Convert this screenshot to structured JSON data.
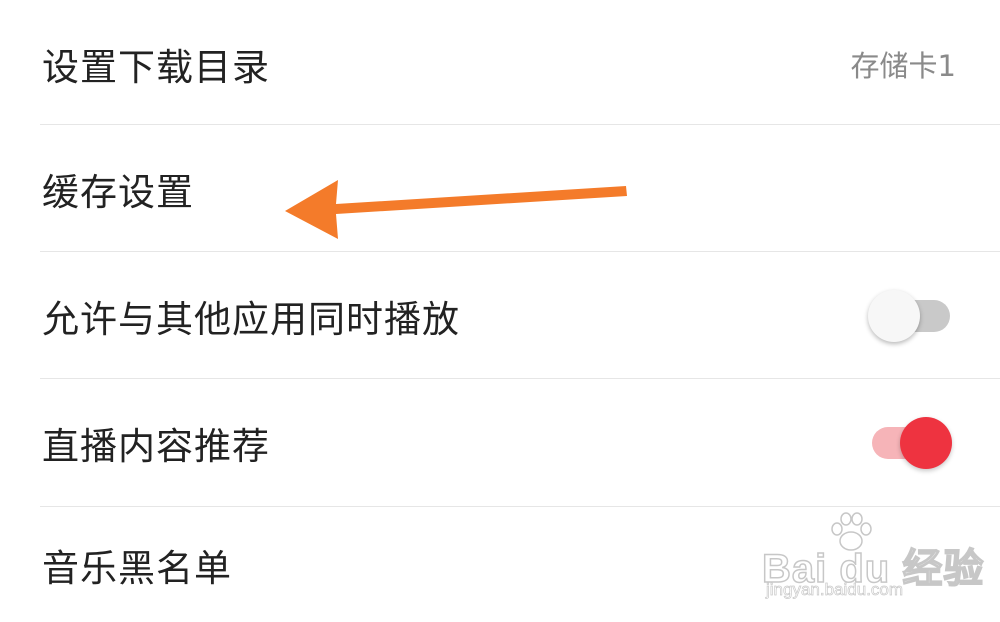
{
  "settings": {
    "rows": [
      {
        "label": "设置下载目录",
        "value": "存储卡1"
      },
      {
        "label": "缓存设置"
      },
      {
        "label": "允许与其他应用同时播放",
        "toggle_on": false
      },
      {
        "label": "直播内容推荐",
        "toggle_on": true
      },
      {
        "label": "音乐黑名单"
      }
    ]
  },
  "colors": {
    "toggle_on_knob": "#ee3340",
    "toggle_on_track": "#f6b4b8",
    "toggle_off_track": "#c9c9c9",
    "annotation_arrow": "#f47b2a"
  },
  "watermark": {
    "logo": "Bai du 经验",
    "url": "jingyan.baidu.com"
  }
}
